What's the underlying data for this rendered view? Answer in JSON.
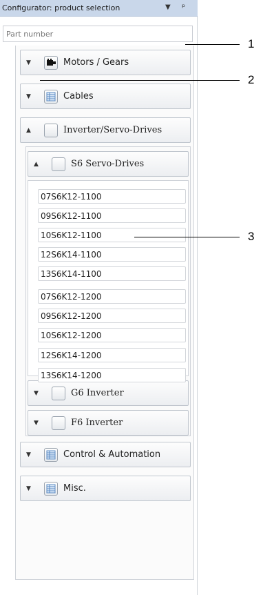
{
  "window": {
    "title": "Configurator: product selection",
    "dropdown_icon": "chevron-down-icon",
    "pin_icon": "pin-icon"
  },
  "search": {
    "placeholder": "Part number"
  },
  "categories": {
    "motors": {
      "label": "Motors / Gears",
      "state": "collapsed",
      "icon": "motor-icon"
    },
    "cables": {
      "label": "Cables",
      "state": "collapsed",
      "icon": "table-icon"
    },
    "inverter": {
      "label": "Inverter/Servo-Drives",
      "state": "expanded",
      "icon": "blank-icon"
    },
    "control": {
      "label": "Control & Automation",
      "state": "collapsed",
      "icon": "table-icon"
    },
    "misc": {
      "label": "Misc.",
      "state": "collapsed",
      "icon": "table-icon"
    }
  },
  "subcategories": {
    "s6": {
      "label": "S6 Servo-Drives",
      "state": "expanded"
    },
    "g6": {
      "label": "G6 Inverter",
      "state": "collapsed"
    },
    "f6": {
      "label": "F6 Inverter",
      "state": "collapsed"
    }
  },
  "s6_items": [
    "07S6K12-1100",
    "09S6K12-1100",
    "10S6K12-1100",
    "12S6K14-1100",
    "13S6K14-1100",
    "07S6K12-1200",
    "09S6K12-1200",
    "10S6K12-1200",
    "12S6K14-1200",
    "13S6K14-1200"
  ],
  "callouts": [
    "1",
    "2",
    "3"
  ]
}
